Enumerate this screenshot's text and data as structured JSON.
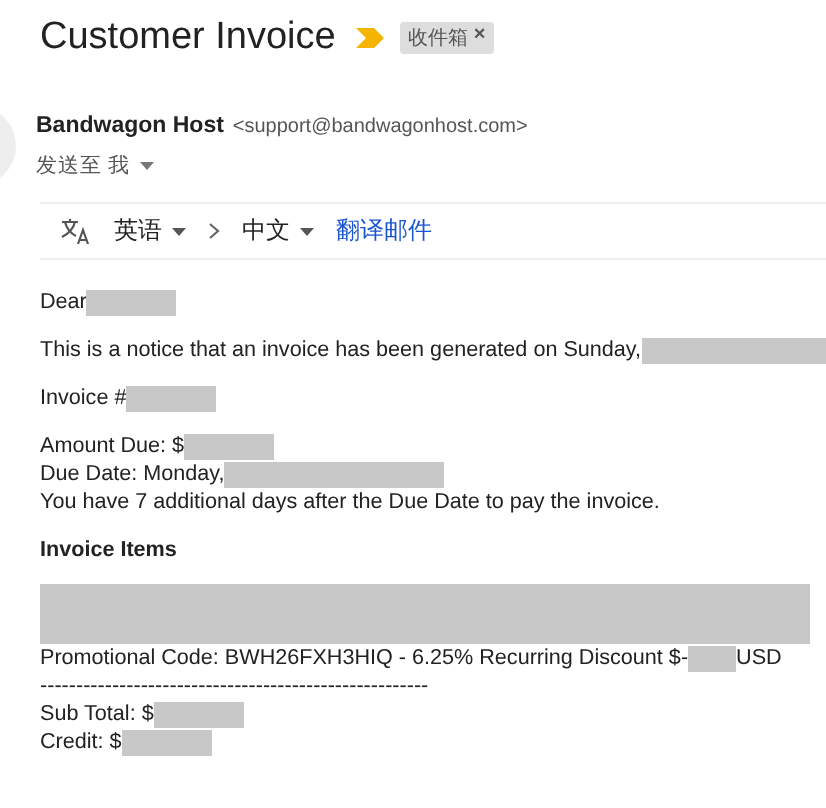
{
  "subject": "Customer Invoice",
  "label_chip": {
    "text": "收件箱",
    "close": "×"
  },
  "sender": {
    "name": "Bandwagon Host",
    "email": "<support@bandwagonhost.com>",
    "recipient": "发送至 我"
  },
  "translate_bar": {
    "source": "英语",
    "target": "中文",
    "action": "翻译邮件"
  },
  "paragraphs": [
    [
      {
        "kind": "field",
        "text": "Dear"
      }
    ],
    [
      {
        "kind": "date",
        "text": "This is a notice that an invoice has been generated on Sunday,"
      }
    ],
    [
      {
        "kind": "field",
        "text": "Invoice #"
      }
    ],
    [
      {
        "kind": "field",
        "text": "Amount Due: $"
      },
      {
        "kind": "date",
        "text": "Due Date: Monday,"
      },
      {
        "kind": "text",
        "text": "You have 7 additional days after the Due Date to pay the invoice."
      }
    ],
    [
      {
        "kind": "heading",
        "text": "Invoice Items"
      }
    ],
    [
      {
        "kind": "redacted"
      },
      {
        "kind": "promo",
        "text": "Promotional Code: BWH26FXH3HIQ - 6.25% Recurring Discount $-",
        "suffix": "USD"
      },
      {
        "kind": "text",
        "text": "------------------------------------------------------"
      },
      {
        "kind": "field",
        "text": "Sub Total: $"
      },
      {
        "kind": "field",
        "text": "Credit: $"
      }
    ]
  ]
}
